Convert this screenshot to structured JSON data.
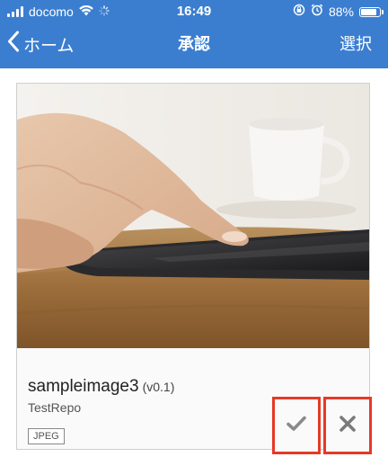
{
  "status_bar": {
    "carrier": "docomo",
    "time": "16:49",
    "battery_percent": "88%",
    "battery_level": 0.88
  },
  "nav": {
    "back_label": "ホーム",
    "title": "承認",
    "select_label": "選択"
  },
  "card": {
    "name": "sampleimage3",
    "version": "(v0.1)",
    "repo": "TestRepo",
    "format_badge": "JPEG"
  },
  "actions": {
    "approve_icon": "checkmark-icon",
    "reject_icon": "close-icon"
  },
  "colors": {
    "header_bg": "#3b7ed0",
    "highlight_border": "#e53a27"
  }
}
